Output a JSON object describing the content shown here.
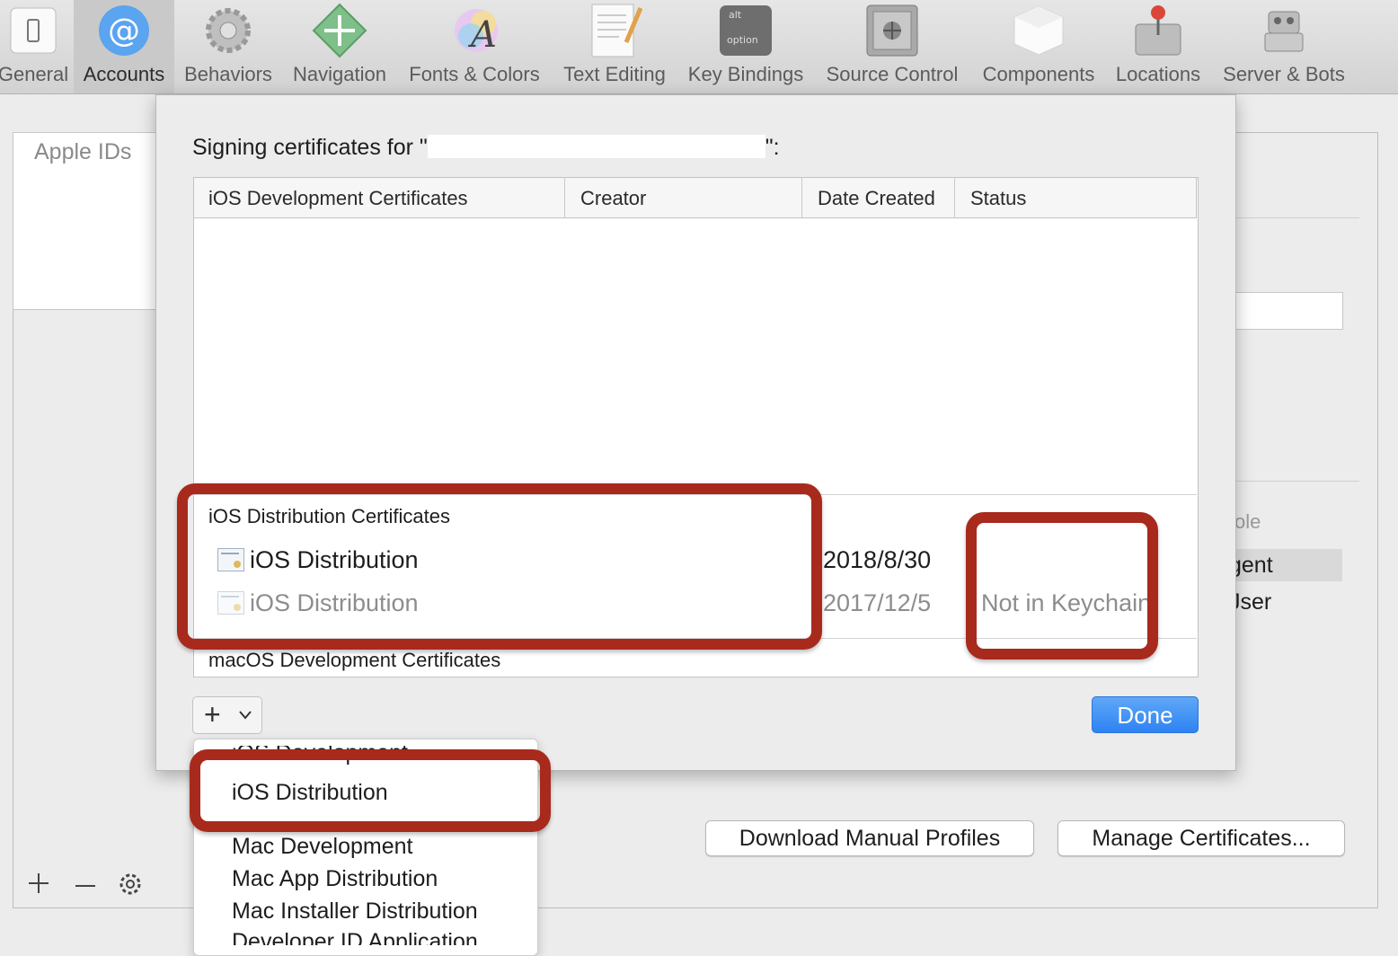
{
  "toolbar": {
    "items": [
      {
        "label": "General",
        "icon": "general-icon"
      },
      {
        "label": "Accounts",
        "icon": "accounts-icon"
      },
      {
        "label": "Behaviors",
        "icon": "gear-icon"
      },
      {
        "label": "Navigation",
        "icon": "navigation-icon"
      },
      {
        "label": "Fonts & Colors",
        "icon": "fonts-icon"
      },
      {
        "label": "Text Editing",
        "icon": "text-editing-icon"
      },
      {
        "label": "Key Bindings",
        "icon": "keyboard-icon"
      },
      {
        "label": "Source Control",
        "icon": "source-control-icon"
      },
      {
        "label": "Components",
        "icon": "components-icon"
      },
      {
        "label": "Locations",
        "icon": "locations-icon"
      },
      {
        "label": "Server & Bots",
        "icon": "server-bots-icon"
      }
    ],
    "selected": "Accounts",
    "key_alt": "alt",
    "key_option": "option"
  },
  "pane": {
    "apple_ids_tab": "Apple IDs",
    "role_header": "ole",
    "role_agent": "gent",
    "role_user": "Jser",
    "download_profiles_button": "Download Manual Profiles",
    "manage_certificates_button": "Manage Certificates..."
  },
  "sheet": {
    "title_prefix": "Signing certificates for \"",
    "title_suffix": "\":",
    "columns": [
      "iOS Development Certificates",
      "Creator",
      "Date Created",
      "Status"
    ],
    "groups": {
      "distribution": {
        "label": "iOS Distribution Certificates",
        "rows": [
          {
            "name": "iOS Distribution",
            "creator": "",
            "date": "2018/8/30",
            "status": ""
          },
          {
            "name": "iOS Distribution",
            "creator": "",
            "date": "2017/12/5",
            "status": "Not in Keychain"
          }
        ]
      },
      "macos": {
        "label": "macOS Development Certificates"
      }
    },
    "add_symbol": "+",
    "done_button": "Done"
  },
  "menu": {
    "items": [
      "iOS Development",
      "iOS Distribution",
      "Mac Development",
      "Mac App Distribution",
      "Mac Installer Distribution",
      "Developer ID Application"
    ]
  },
  "colors": {
    "annotation": "#a82a1c",
    "accent": "#2e83f3",
    "toolbar_selected": "#c9c9c9"
  }
}
